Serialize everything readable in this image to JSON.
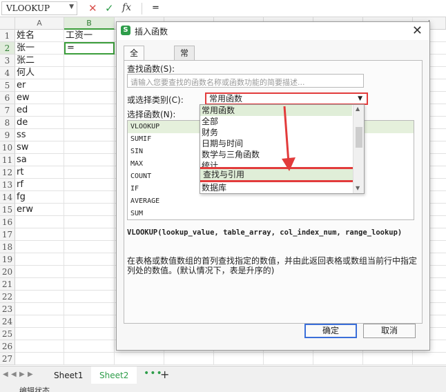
{
  "formula_bar": {
    "name_box": "VLOOKUP",
    "cancel_icon": "✕",
    "enter_icon": "✓",
    "fx_label": "fx",
    "content": "="
  },
  "columns": [
    "A",
    "B",
    "",
    "",
    "",
    "",
    "",
    "",
    "",
    "",
    "I"
  ],
  "rows": [
    "1",
    "2",
    "3",
    "4",
    "5",
    "6",
    "7",
    "8",
    "9",
    "10",
    "11",
    "12",
    "13",
    "14",
    "15",
    "16",
    "17",
    "18",
    "19",
    "20",
    "21",
    "22",
    "23",
    "24",
    "25",
    "26",
    "27"
  ],
  "cells": {
    "A": [
      "姓名",
      "张一",
      "张二",
      "何人",
      "er",
      "ew",
      "ed",
      "de",
      "ss",
      "sw",
      "sa",
      "rt",
      "rf",
      "fg",
      "erw"
    ],
    "B1": "工资一",
    "B2": "="
  },
  "sheet_tabs": {
    "tabs": [
      "Sheet1",
      "Sheet2"
    ],
    "more": "•••",
    "add": "+"
  },
  "status": {
    "text": "编辑状态"
  },
  "dialog": {
    "title": "插入函数",
    "logo": "S",
    "close": "✕",
    "tabs": [
      "全部函数",
      "常用公式"
    ],
    "search_label": "查找函数(S):",
    "search_placeholder": "请输入您要查找的函数名称或函数功能的简要描述...",
    "category_label": "或选择类别(C):",
    "category_value": "常用函数",
    "function_label": "选择函数(N):",
    "functions": [
      "VLOOKUP",
      "SUMIF",
      "SIN",
      "MAX",
      "COUNT",
      "IF",
      "AVERAGE",
      "SUM"
    ],
    "syntax": "VLOOKUP(lookup_value, table_array, col_index_num, range_lookup)",
    "description": "在表格或数值数组的首列查找指定的数值，并由此返回表格或数组当前行中指定列处的数值。(默认情况下，表是升序的)",
    "ok": "确定",
    "cancel": "取消"
  },
  "dropdown": {
    "options": [
      "常用函数",
      "全部",
      "财务",
      "日期与时间",
      "数学与三角函数",
      "统计",
      "查找与引用",
      "数据库"
    ]
  },
  "colors": {
    "accent_green": "#2e9d4a",
    "highlight_red": "#e23b3b"
  }
}
